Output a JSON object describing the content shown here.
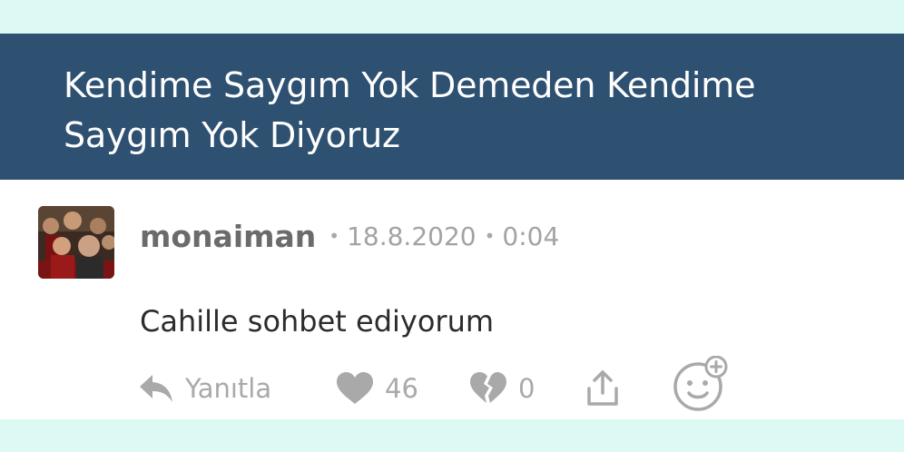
{
  "header": {
    "title": "Kendime Saygım Yok Demeden Kendime Saygım Yok Diyoruz"
  },
  "comment": {
    "username": "monaiman",
    "separator": "•",
    "date": "18.8.2020",
    "time": "0:04",
    "text": "Cahille sohbet ediyorum"
  },
  "actions": {
    "reply_label": "Yanıtla",
    "like_count": "46",
    "dislike_count": "0"
  },
  "icons": {
    "reply": "reply-arrow-icon",
    "like": "heart-icon",
    "dislike": "broken-heart-icon",
    "share": "share-icon",
    "reaction": "add-reaction-smiley-icon"
  },
  "colors": {
    "header_bg": "#2e5071",
    "page_bg": "#dcfaf3",
    "muted": "#a9a9a9",
    "username": "#6b6b6b",
    "text": "#2c2c2c"
  }
}
